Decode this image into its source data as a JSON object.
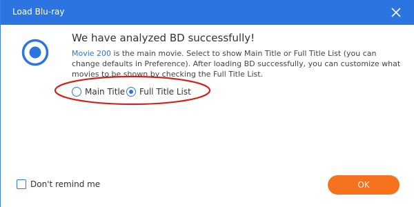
{
  "window": {
    "title": "Load Blu-ray"
  },
  "message": {
    "heading": "We have analyzed BD successfully!",
    "movie_link": "Movie 200",
    "description_rest": " is the main movie. Select to show Main Title or Full Title List (you can change defaults in Preference). After loading BD successfully, you can customize what movies to be shown by checking the Full Title List."
  },
  "options": [
    {
      "label": "Main Title",
      "checked": false
    },
    {
      "label": "Full Title List",
      "checked": true
    }
  ],
  "footer": {
    "dont_remind_label": "Don't remind me",
    "dont_remind_checked": false,
    "ok_label": "OK"
  },
  "colors": {
    "titlebar": "#2c75e1",
    "accent": "#2c75e1",
    "ok_button": "#f5711c",
    "annotation": "#d0211b"
  },
  "icons": {
    "close": "close-icon",
    "main": "radio-disc-icon"
  }
}
